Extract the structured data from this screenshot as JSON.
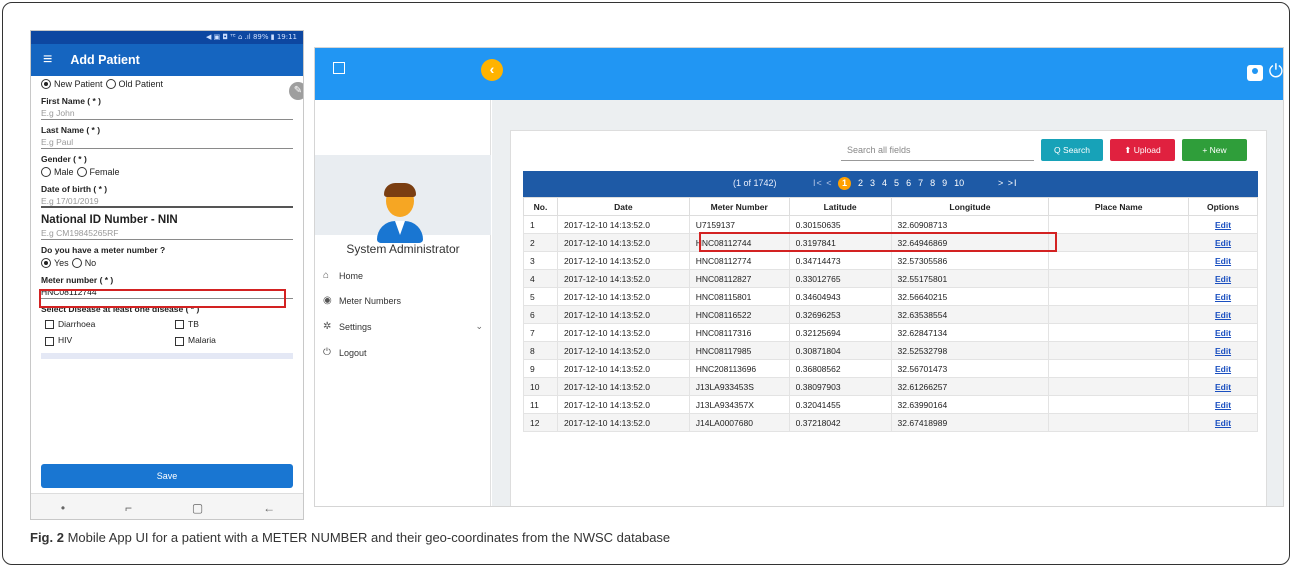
{
  "mobile": {
    "status_text": "◀ ▣ ◘ ᵀᴱ ⌂ .ıl 89% ▮ 19:11",
    "menu_icon": "menu-icon",
    "title": "Add Patient",
    "patient_type": {
      "new_label": "New Patient",
      "old_label": "Old Patient",
      "selected": "new"
    },
    "first_name": {
      "label": "First Name ( * )",
      "placeholder": "E.g John"
    },
    "last_name": {
      "label": "Last Name ( * )",
      "placeholder": "E.g Paul"
    },
    "gender": {
      "label": "Gender ( * )",
      "male_label": "Male",
      "female_label": "Female"
    },
    "dob": {
      "label": "Date of birth ( * )",
      "placeholder": "E.g 17/01/2019"
    },
    "nin": {
      "label": "National ID Number - NIN",
      "placeholder": "E.g CM19845265RF"
    },
    "has_meter": {
      "label": "Do you have a meter number ?",
      "yes_label": "Yes",
      "no_label": "No",
      "selected": "yes"
    },
    "meter_number": {
      "label": "Meter number ( * )",
      "value": "HNC08112744"
    },
    "disease": {
      "label": "Select Disease at least one disease ( * )",
      "options": [
        "Diarrhoea",
        "TB",
        "HIV",
        "Malaria"
      ]
    },
    "save_label": "Save",
    "nav": {
      "dot": "•",
      "recent": "⌐",
      "home": "▢",
      "back": "←"
    }
  },
  "web": {
    "user_name": "System Administrator",
    "menu": [
      {
        "label": "Home",
        "icon": "⌂"
      },
      {
        "label": "Meter Numbers",
        "icon": "◉"
      },
      {
        "label": "Settings",
        "icon": "✲",
        "chevron": "⌄"
      },
      {
        "label": "Logout",
        "icon": "⏻"
      }
    ],
    "collapse_glyph": "‹",
    "power_glyph": "⏻",
    "toolbar": {
      "search_placeholder": "Search all fields",
      "search_label": "Q Search",
      "upload_label": "⬆ Upload",
      "new_label": "+ New"
    },
    "pager": {
      "info": "(1 of 1742)",
      "first_prev": "I< <",
      "current": "1",
      "pages": [
        "2",
        "3",
        "4",
        "5",
        "6",
        "7",
        "8",
        "9",
        "10"
      ],
      "next_last": "> >I"
    },
    "columns": [
      "No.",
      "Date",
      "Meter Number",
      "Latitude",
      "Longitude",
      "Place Name",
      "Options"
    ],
    "rows": [
      [
        "1",
        "2017-12-10 14:13:52.0",
        "U7159137",
        "0.30150635",
        "32.60908713",
        "",
        "Edit"
      ],
      [
        "2",
        "2017-12-10 14:13:52.0",
        "HNC08112744",
        "0.3197841",
        "32.64946869",
        "",
        "Edit"
      ],
      [
        "3",
        "2017-12-10 14:13:52.0",
        "HNC08112774",
        "0.34714473",
        "32.57305586",
        "",
        "Edit"
      ],
      [
        "4",
        "2017-12-10 14:13:52.0",
        "HNC08112827",
        "0.33012765",
        "32.55175801",
        "",
        "Edit"
      ],
      [
        "5",
        "2017-12-10 14:13:52.0",
        "HNC08115801",
        "0.34604943",
        "32.56640215",
        "",
        "Edit"
      ],
      [
        "6",
        "2017-12-10 14:13:52.0",
        "HNC08116522",
        "0.32696253",
        "32.63538554",
        "",
        "Edit"
      ],
      [
        "7",
        "2017-12-10 14:13:52.0",
        "HNC08117316",
        "0.32125694",
        "32.62847134",
        "",
        "Edit"
      ],
      [
        "8",
        "2017-12-10 14:13:52.0",
        "HNC08117985",
        "0.30871804",
        "32.52532798",
        "",
        "Edit"
      ],
      [
        "9",
        "2017-12-10 14:13:52.0",
        "HNC208113696",
        "0.36808562",
        "32.56701473",
        "",
        "Edit"
      ],
      [
        "10",
        "2017-12-10 14:13:52.0",
        "J13LA933453S",
        "0.38097903",
        "32.61266257",
        "",
        "Edit"
      ],
      [
        "11",
        "2017-12-10 14:13:52.0",
        "J13LA934357X",
        "0.32041455",
        "32.63990164",
        "",
        "Edit"
      ],
      [
        "12",
        "2017-12-10 14:13:52.0",
        "J14LA0007680",
        "0.37218042",
        "32.67418989",
        "",
        "Edit"
      ]
    ]
  },
  "caption": {
    "label": "Fig. 2",
    "text": " Mobile App UI for a patient with a METER NUMBER and their geo-coordinates from the NWSC database"
  },
  "colors": {
    "appbar": "#1565c0",
    "topbar": "#2196f3",
    "highlight": "#d32222",
    "pager": "#1e5aa6",
    "current_page": "#ffa000"
  }
}
